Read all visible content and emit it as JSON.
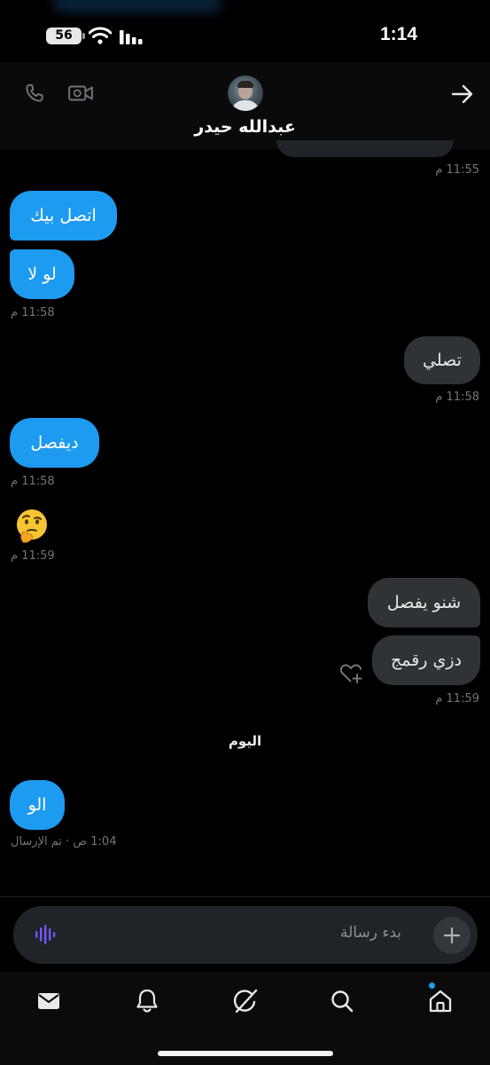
{
  "status_bar": {
    "battery": "56",
    "time": "1:14"
  },
  "header": {
    "contact_name": "عبدالله حيدر",
    "icons": [
      "phone-icon",
      "video-call-icon",
      "back-arrow-icon",
      "avatar"
    ]
  },
  "messages": [
    {
      "type": "timestamp",
      "side": "right",
      "text": "11:55 م"
    },
    {
      "type": "text",
      "side": "left",
      "color": "#1d9bf0",
      "text": "اتصل بيك"
    },
    {
      "type": "text",
      "side": "left",
      "color": "#1d9bf0",
      "text": "لو لا"
    },
    {
      "type": "timestamp",
      "side": "left",
      "text": "11:58 م"
    },
    {
      "type": "text",
      "side": "right",
      "color": "#2f3336",
      "text": "تصلي"
    },
    {
      "type": "timestamp",
      "side": "right",
      "text": "11:58 م"
    },
    {
      "type": "text",
      "side": "left",
      "color": "#1d9bf0",
      "text": "ديفصل"
    },
    {
      "type": "timestamp",
      "side": "left",
      "text": "11:58 م"
    },
    {
      "type": "emoji",
      "side": "left",
      "icon": "thinking-face-emoji"
    },
    {
      "type": "timestamp",
      "side": "left",
      "text": "11:59 م"
    },
    {
      "type": "text",
      "side": "right",
      "color": "#2f3336",
      "text": "شنو يفصل"
    },
    {
      "type": "text",
      "side": "right",
      "color": "#2f3336",
      "text": "دزي رقمج"
    },
    {
      "type": "timestamp",
      "side": "right",
      "text": "11:59 م"
    },
    {
      "type": "day_separator",
      "text": "اليوم"
    },
    {
      "type": "text",
      "side": "left",
      "color": "#1d9bf0",
      "text": "الو"
    },
    {
      "type": "timestamp",
      "side": "left",
      "text": "1:04 ص · تم الإرسال"
    }
  ],
  "composer": {
    "placeholder": "بدء رسالة",
    "icons": [
      "voice-message-icon",
      "add-icon"
    ]
  },
  "tabbar": {
    "tabs": [
      "messages-tab",
      "notifications-tab",
      "grok-tab",
      "search-tab",
      "home-tab"
    ],
    "active_badge_color": "#1d9bf0"
  },
  "colors": {
    "accent": "#1d9bf0",
    "background": "#000000",
    "received_bubble": "#2f3336",
    "muted_text": "#71767b"
  }
}
